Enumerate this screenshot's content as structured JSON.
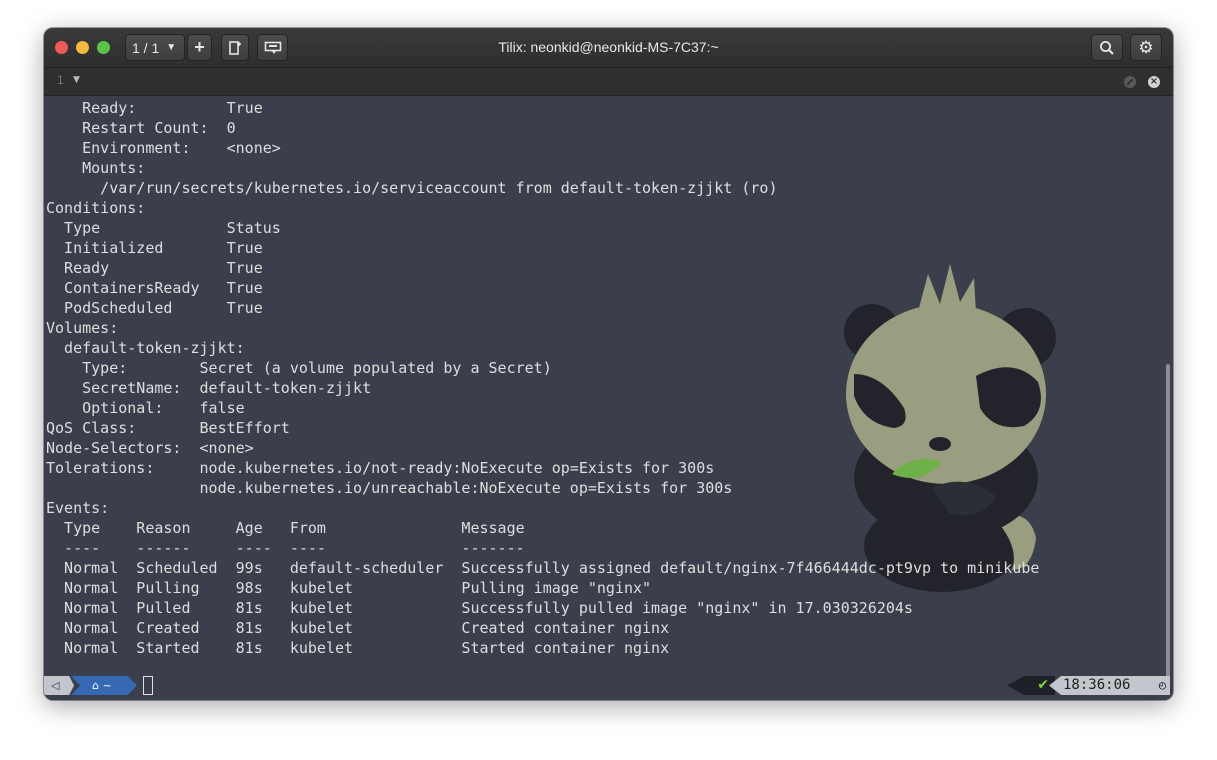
{
  "window": {
    "title": "Tilix: neonkid@neonkid-MS-7C37:~"
  },
  "toolbar": {
    "session_label": "1 / 1",
    "add_label": "+"
  },
  "subbar": {
    "terminal_number": "1"
  },
  "terminal": {
    "lines": [
      "    Ready:          True",
      "    Restart Count:  0",
      "    Environment:    <none>",
      "    Mounts:",
      "      /var/run/secrets/kubernetes.io/serviceaccount from default-token-zjjkt (ro)",
      "Conditions:",
      "  Type              Status",
      "  Initialized       True",
      "  Ready             True",
      "  ContainersReady   True",
      "  PodScheduled      True",
      "Volumes:",
      "  default-token-zjjkt:",
      "    Type:        Secret (a volume populated by a Secret)",
      "    SecretName:  default-token-zjjkt",
      "    Optional:    false",
      "QoS Class:       BestEffort",
      "Node-Selectors:  <none>",
      "Tolerations:     node.kubernetes.io/not-ready:NoExecute op=Exists for 300s",
      "                 node.kubernetes.io/unreachable:NoExecute op=Exists for 300s",
      "Events:",
      "  Type    Reason     Age   From               Message",
      "  ----    ------     ----  ----               -------",
      "  Normal  Scheduled  99s   default-scheduler  Successfully assigned default/nginx-7f466444dc-pt9vp to minikube",
      "  Normal  Pulling    98s   kubelet            Pulling image \"nginx\"",
      "  Normal  Pulled     81s   kubelet            Successfully pulled image \"nginx\" in 17.030326204s",
      "  Normal  Created    81s   kubelet            Created container nginx",
      "  Normal  Started    81s   kubelet            Started container nginx"
    ]
  },
  "prompt": {
    "dir": "~",
    "status_check": "✔",
    "time": "18:36:06"
  },
  "colors": {
    "terminal_bg": "#3b3f4b",
    "text": "#dedede",
    "dir_segment": "#3668b3",
    "ok_check": "#7ed640",
    "panda_fur": "#9a9e80"
  }
}
